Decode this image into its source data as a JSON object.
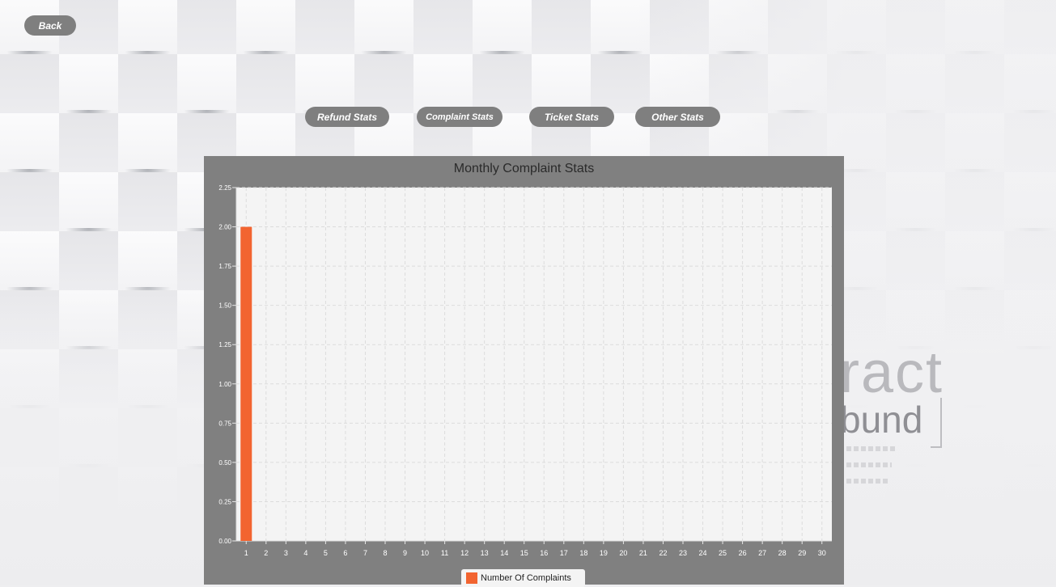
{
  "nav": {
    "back_label": "Back",
    "tabs": [
      "Refund Stats",
      "Complaint Stats",
      "Ticket Stats",
      "Other Stats"
    ]
  },
  "background": {
    "partial_word_1": "ract",
    "partial_word_2": "bund"
  },
  "colors": {
    "button_bg": "#7f7f7f",
    "chart_frame": "#808080",
    "plot_bg": "#f4f4f4",
    "bar": "#f26430"
  },
  "chart_data": {
    "type": "bar",
    "title": "Monthly Complaint Stats",
    "xlabel": "",
    "ylabel": "",
    "categories": [
      "1",
      "2",
      "3",
      "4",
      "5",
      "6",
      "7",
      "8",
      "9",
      "10",
      "11",
      "12",
      "13",
      "14",
      "15",
      "16",
      "17",
      "18",
      "19",
      "20",
      "21",
      "22",
      "23",
      "24",
      "25",
      "26",
      "27",
      "28",
      "29",
      "30"
    ],
    "series": [
      {
        "name": "Number Of Complaints",
        "values": [
          2,
          0,
          0,
          0,
          0,
          0,
          0,
          0,
          0,
          0,
          0,
          0,
          0,
          0,
          0,
          0,
          0,
          0,
          0,
          0,
          0,
          0,
          0,
          0,
          0,
          0,
          0,
          0,
          0,
          0
        ]
      }
    ],
    "ylim": [
      0,
      2.25
    ],
    "yticks": [
      "0.00",
      "0.25",
      "0.50",
      "0.75",
      "1.00",
      "1.25",
      "1.50",
      "1.75",
      "2.00",
      "2.25"
    ],
    "grid": true,
    "legend_position": "bottom"
  }
}
